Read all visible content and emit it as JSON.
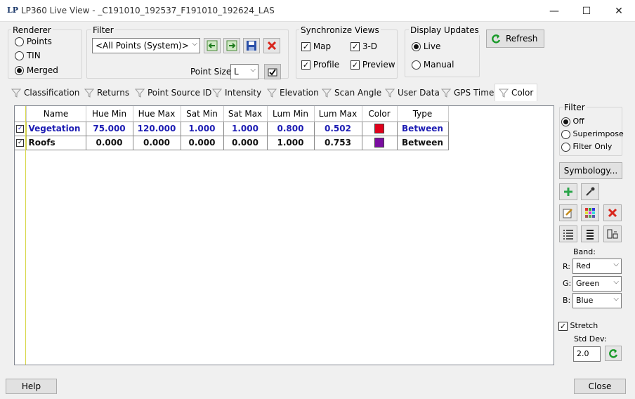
{
  "window": {
    "logo": "LP",
    "title": "LP360 Live View - _C191010_192537_F191010_192624_LAS",
    "minimize_glyph": "—",
    "maximize_glyph": "☐",
    "close_glyph": "✕"
  },
  "renderer": {
    "label": "Renderer",
    "options": [
      "Points",
      "TIN",
      "Merged"
    ],
    "selected": "Merged"
  },
  "filter": {
    "label": "Filter",
    "value": "<All Points (System)>",
    "point_size_label": "Point Size:",
    "point_size_value": "L"
  },
  "sync": {
    "label": "Synchronize Views",
    "items": [
      {
        "label": "Map",
        "checked": true
      },
      {
        "label": "3-D",
        "checked": true
      },
      {
        "label": "Profile",
        "checked": true
      },
      {
        "label": "Preview",
        "checked": true
      }
    ]
  },
  "display_updates": {
    "label": "Display Updates",
    "options": [
      "Live",
      "Manual"
    ],
    "selected": "Live"
  },
  "refresh_label": "Refresh",
  "tabs": [
    "Classification",
    "Returns",
    "Point Source ID",
    "Intensity",
    "Elevation",
    "Scan Angle",
    "User Data",
    "GPS Time",
    "Color"
  ],
  "active_tab": "Color",
  "table": {
    "columns": [
      "Name",
      "Hue Min",
      "Hue Max",
      "Sat Min",
      "Sat Max",
      "Lum Min",
      "Lum Max",
      "Color",
      "Type"
    ],
    "rows": [
      {
        "checked": true,
        "name": "Vegetation",
        "hue_min": "75.000",
        "hue_max": "120.000",
        "sat_min": "1.000",
        "sat_max": "1.000",
        "lum_min": "0.800",
        "lum_max": "0.502",
        "color": "#e0001b",
        "type": "Between"
      },
      {
        "checked": true,
        "name": "Roofs",
        "hue_min": "0.000",
        "hue_max": "0.000",
        "sat_min": "0.000",
        "sat_max": "0.000",
        "lum_min": "1.000",
        "lum_max": "0.753",
        "color": "#7a0da0",
        "type": "Between"
      }
    ]
  },
  "right_filter": {
    "label": "Filter",
    "options": [
      "Off",
      "Superimpose",
      "Filter Only"
    ],
    "selected": "Off"
  },
  "symbology_label": "Symbology...",
  "band": {
    "label": "Band:",
    "r_label": "R:",
    "r_value": "Red",
    "g_label": "G:",
    "g_value": "Green",
    "b_label": "B:",
    "b_value": "Blue"
  },
  "stretch": {
    "label": "Stretch",
    "checked": true,
    "std_dev_label": "Std Dev:",
    "std_dev_value": "2.0"
  },
  "help_label": "Help",
  "close_label": "Close"
}
